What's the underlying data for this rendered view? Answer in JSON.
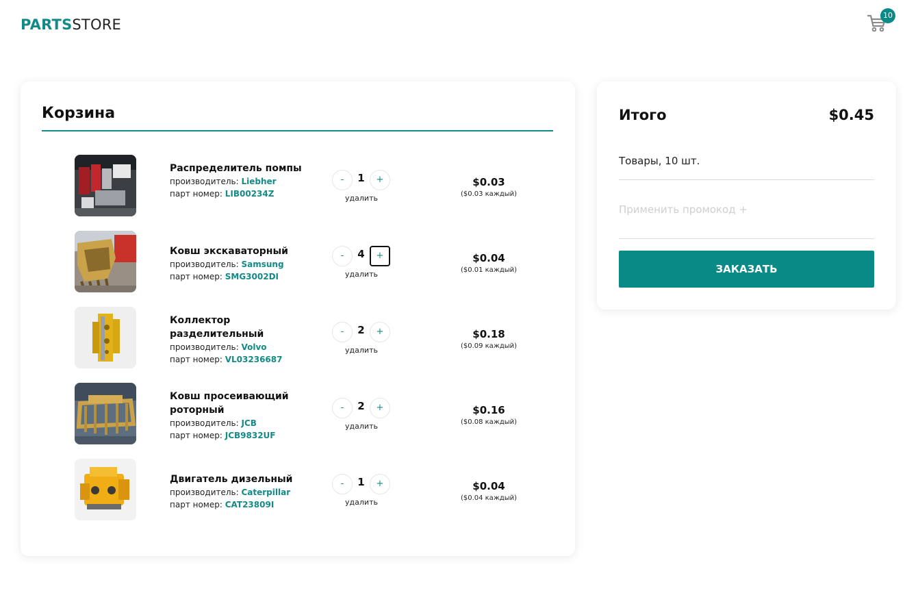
{
  "header": {
    "logo_accent": "PARTS",
    "logo_rest": "STORE",
    "cart_count": "10"
  },
  "cart": {
    "title": "Корзина",
    "manufacturer_label": "производитель:",
    "part_label": "парт номер:",
    "remove_label": "удалить",
    "minus_label": "-",
    "plus_label": "+",
    "items": [
      {
        "name": "Распределитель помпы",
        "manufacturer": "Liebher",
        "part_number": "LIB00234Z",
        "qty": "1",
        "total": "$0.03",
        "each": "($0.03 каждый)"
      },
      {
        "name": "Ковш экскаваторный",
        "manufacturer": "Samsung",
        "part_number": "SMG3002DI",
        "qty": "4",
        "total": "$0.04",
        "each": "($0.01 каждый)"
      },
      {
        "name": "Коллектор разделительный",
        "manufacturer": "Volvo",
        "part_number": "VL03236687",
        "qty": "2",
        "total": "$0.18",
        "each": "($0.09 каждый)"
      },
      {
        "name": "Ковш просеивающий роторный",
        "manufacturer": "JCB",
        "part_number": "JCB9832UF",
        "qty": "2",
        "total": "$0.16",
        "each": "($0.08 каждый)"
      },
      {
        "name": "Двигатель дизельный",
        "manufacturer": "Caterpillar",
        "part_number": "CAT23809I",
        "qty": "1",
        "total": "$0.04",
        "each": "($0.04 каждый)"
      }
    ]
  },
  "summary": {
    "title": "Итого",
    "total": "$0.45",
    "items_count": "Товары, 10 шт.",
    "promo": "Применить промокод +",
    "order_button": "ЗАКАЗАТЬ"
  },
  "colors": {
    "accent": "#0a8a87",
    "brand_text": "#138a87"
  }
}
